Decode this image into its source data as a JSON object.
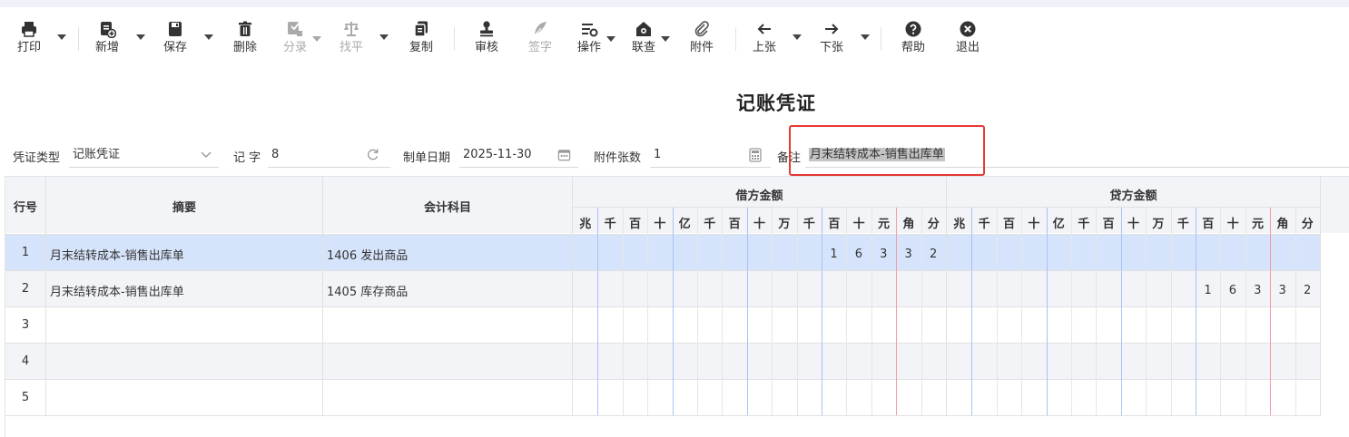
{
  "toolbar": {
    "print": "打印",
    "add": "新增",
    "save": "保存",
    "delete": "删除",
    "entry": "分录",
    "balance": "找平",
    "copy": "复制",
    "audit": "审核",
    "sign": "签字",
    "operate": "操作",
    "query": "联查",
    "attach": "附件",
    "prev": "上张",
    "next": "下张",
    "help": "帮助",
    "exit": "退出"
  },
  "title": "记账凭证",
  "form": {
    "voucher_type_label": "凭证类型",
    "voucher_type_value": "记账凭证",
    "word_label": "记 字",
    "word_value": "8",
    "date_label": "制单日期",
    "date_value": "2025-11-30",
    "attach_label": "附件张数",
    "attach_value": "1",
    "remark_label": "备注",
    "remark_value": "月末结转成本-销售出库单"
  },
  "table": {
    "col_line": "行号",
    "col_summary": "摘要",
    "col_account": "会计科目",
    "debit_header": "借方金额",
    "credit_header": "贷方金额",
    "digit_units": [
      "兆",
      "千",
      "百",
      "十",
      "亿",
      "千",
      "百",
      "十",
      "万",
      "千",
      "百",
      "十",
      "元",
      "角",
      "分"
    ],
    "rows": [
      {
        "no": "1",
        "summary": "月末结转成本-销售出库单",
        "account": "1406 发出商品",
        "debit": "16332",
        "credit": ""
      },
      {
        "no": "2",
        "summary": "月末结转成本-销售出库单",
        "account": "1405 库存商品",
        "debit": "",
        "credit": "16332"
      },
      {
        "no": "3",
        "summary": "",
        "account": "",
        "debit": "",
        "credit": ""
      },
      {
        "no": "4",
        "summary": "",
        "account": "",
        "debit": "",
        "credit": ""
      },
      {
        "no": "5",
        "summary": "",
        "account": "",
        "debit": "",
        "credit": ""
      }
    ]
  },
  "colors": {
    "selected_row": "#d6e4fb",
    "alt_row": "#f3f4f8",
    "blue_divider": "#a9c3f5",
    "red_divider": "#f2a0a6",
    "highlight_box": "#e53935"
  },
  "icons": [
    "printer-icon",
    "add-doc-icon",
    "save-icon",
    "trash-icon",
    "entry-icon",
    "scale-icon",
    "copy-icon",
    "stamp-icon",
    "feather-icon",
    "operate-icon",
    "link-home-icon",
    "paperclip-icon",
    "arrow-left-icon",
    "arrow-right-icon",
    "help-icon",
    "close-circle-icon",
    "chevron-down-icon",
    "refresh-icon",
    "calendar-icon",
    "calculator-icon"
  ]
}
